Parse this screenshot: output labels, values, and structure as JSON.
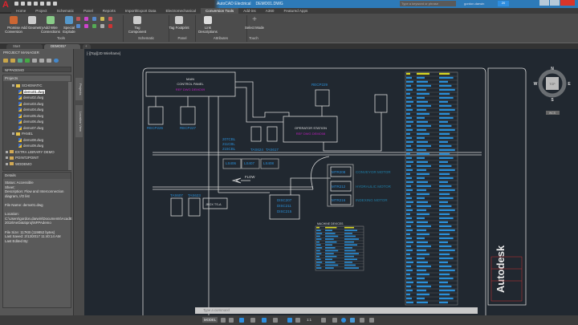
{
  "app": {
    "title": "AutoCAD Electrical",
    "file": "DEMO01.DWG",
    "logo": "A"
  },
  "header": {
    "search_placeholder": "Type a keyword or phrase",
    "user": "gordon.darwin",
    "timer": "20"
  },
  "ribbon": {
    "tabs": [
      "Home",
      "Project",
      "Schematic",
      "Panel",
      "Reports",
      "Import/Export Data",
      "Electromechanical",
      "Conversion Tools",
      "Add-ins",
      "A360",
      "Featured Apps"
    ],
    "active_tab": "Conversion Tools",
    "buttons": {
      "premise": "Promise Conversion",
      "geometry": "Add Geometry",
      "wire": "Add Wire Connections",
      "explode": "Special Explode",
      "tag_component": "Tag Component",
      "tag_footprint": "Tag Footprint",
      "link": "Link Descriptions",
      "select": "Select Mode"
    },
    "panels": {
      "tools": "Tools",
      "schematic": "Schematic",
      "panel": "Panel",
      "attributes": "Attributes",
      "touch": "Touch"
    }
  },
  "doc_tabs": [
    "Start",
    "DEMO01*"
  ],
  "palette": {
    "title": "PROJECT MANAGER",
    "project": "NFPADEMO",
    "projects_header": "Projects",
    "tree": [
      {
        "label": "SCHEMATIC",
        "type": "folder",
        "level": 1
      },
      {
        "label": "demo01.dwg",
        "type": "drawing",
        "level": 2,
        "selected": true
      },
      {
        "label": "demo02.dwg",
        "type": "drawing",
        "level": 2
      },
      {
        "label": "demo03.dwg",
        "type": "drawing",
        "level": 2
      },
      {
        "label": "demo04.dwg",
        "type": "drawing",
        "level": 2
      },
      {
        "label": "demo05.dwg",
        "type": "drawing",
        "level": 2
      },
      {
        "label": "demo06.dwg",
        "type": "drawing",
        "level": 2
      },
      {
        "label": "demo07.dwg",
        "type": "drawing",
        "level": 2
      },
      {
        "label": "PANEL",
        "type": "folder",
        "level": 1
      },
      {
        "label": "demo08.dwg",
        "type": "drawing",
        "level": 2
      },
      {
        "label": "demo09.dwg",
        "type": "drawing",
        "level": 2
      },
      {
        "label": "EXTRA LIBRARY DEMO",
        "type": "project",
        "level": 0
      },
      {
        "label": "POINT2POINT",
        "type": "project",
        "level": 0
      },
      {
        "label": "WDDEMO",
        "type": "project",
        "level": 0
      }
    ],
    "vertical_tabs": [
      "Projects",
      "Location View"
    ],
    "details_header": "Details",
    "details": [
      "Status: Accessible",
      "Sheet:",
      "Description: Flow and Interconnection diagram, I/O list",
      "",
      "File Name: demo01.dwg",
      "",
      "Location: C:\\Users\\gordon.darwin\\Documents\\AcadE 2018\\AeData\\proj\\NFPAdemo",
      "",
      "File Size: 117KB (119852 bytes)",
      "Last Saved: 2/13/2017 11:40:14 AM",
      "Last Edited By:"
    ]
  },
  "viewport": {
    "label": "[-][Top][2D Wireframe]"
  },
  "drawing": {
    "main_panel": [
      "MAIN",
      "CONTROL PANEL"
    ],
    "ref1": "REF DWG DEMO09",
    "operator": "OPERATOR STATION",
    "ref2": "REF DWG DEMO08",
    "recp": [
      "RECP226",
      "RECP227",
      "RECP229"
    ],
    "cables": [
      "207CBL",
      "211CBL",
      "215CBL"
    ],
    "tas": [
      "TAS624",
      "TAS617",
      "TAS607",
      "TAS623"
    ],
    "ls": [
      "LS406",
      "LS407",
      "LS408"
    ],
    "flow": "FLOW",
    "motors": [
      {
        "tag": "MTR208",
        "desc": "CONVEYOR MOTOR"
      },
      {
        "tag": "MTR212",
        "desc": "HYDRAULIC MOTOR"
      },
      {
        "tag": "MTR216",
        "desc": "INDEXING MOTOR"
      }
    ],
    "disc": [
      "DISC207",
      "DISC211",
      "DISC215"
    ],
    "jbox": "JBOX TS-A",
    "machine_devices": "MACHINE DEVICES",
    "brand": "Autodesk"
  },
  "viewcube": {
    "n": "N",
    "s": "S",
    "e": "E",
    "w": "W",
    "face": "TOP",
    "wcs": "WCS"
  },
  "command": {
    "placeholder": "Type a command"
  },
  "status": {
    "model": "MODEL",
    "scale": "1:1"
  },
  "colors": {
    "accent": "#2d7ab8",
    "canvas": "#212830",
    "cyan": "#2a8fd8",
    "magenta": "#c01fc0"
  }
}
